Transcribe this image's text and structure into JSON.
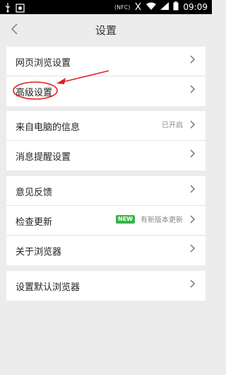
{
  "status_bar": {
    "time": "09:09",
    "nfc": "(NFC)"
  },
  "header": {
    "title": "设置"
  },
  "groups": [
    {
      "items": [
        {
          "label": "网页浏览设置"
        },
        {
          "label": "高级设置"
        }
      ]
    },
    {
      "items": [
        {
          "label": "来自电脑的信息",
          "status": "已开启"
        },
        {
          "label": "消息提醒设置"
        }
      ]
    },
    {
      "items": [
        {
          "label": "意见反馈"
        },
        {
          "label": "检查更新",
          "badge": "NEW",
          "status": "有新版本更新"
        },
        {
          "label": "关于浏览器"
        }
      ]
    },
    {
      "items": [
        {
          "label": "设置默认浏览器"
        }
      ]
    }
  ],
  "colors": {
    "accent_green": "#3bb34a",
    "annotation_red": "#e02020"
  }
}
